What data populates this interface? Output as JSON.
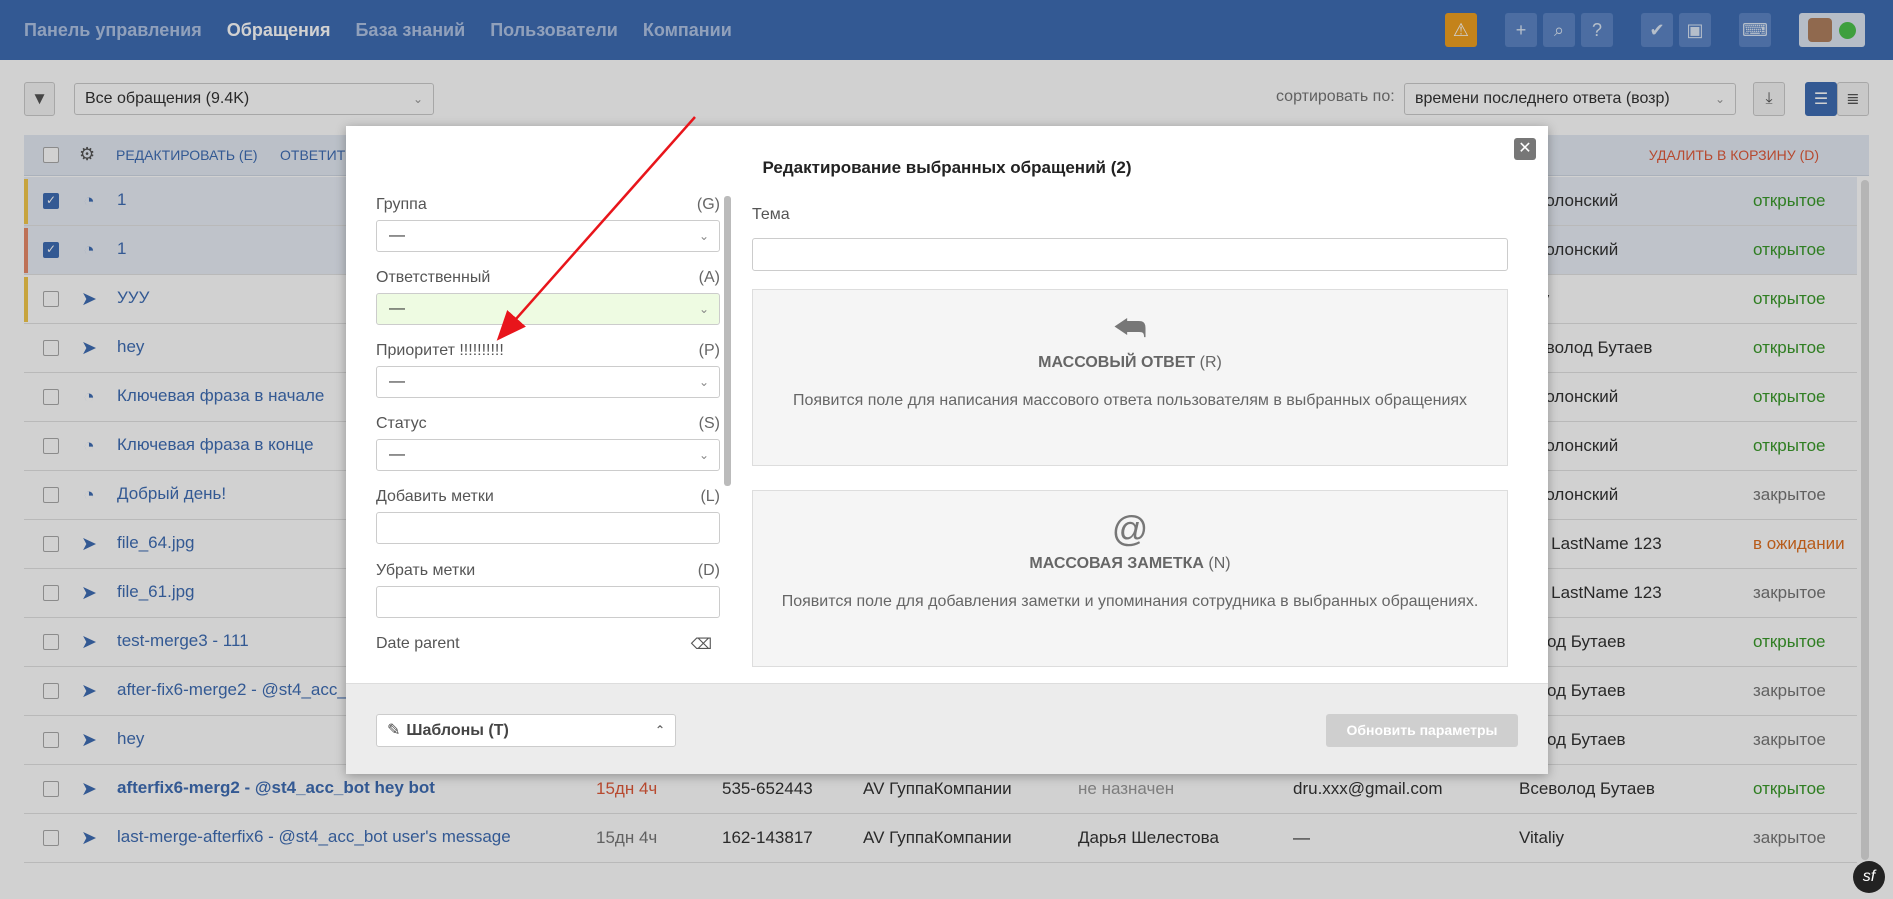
{
  "topbar": {
    "nav": [
      "Панель управления",
      "Обращения",
      "База знаний",
      "Пользователи",
      "Компании"
    ],
    "icons": [
      "warning-icon",
      "plus-icon",
      "search-icon",
      "help-icon",
      "check-icon",
      "briefcase-icon",
      "keyboard-icon"
    ]
  },
  "filterbar": {
    "view_select": "Все обращения (9.4K)",
    "sort_label": "сортировать по:",
    "sort_select": "времени последнего ответа (возр)"
  },
  "listhead": {
    "edit": "РЕДАКТИРОВАТЬ (E)",
    "reply": "ОТВЕТИТЬ",
    "delete": "УДАЛИТЬ В КОРЗИНУ (D)"
  },
  "rows": [
    {
      "subject": "1",
      "who": "н Полонский",
      "status": "открытое",
      "stclass": "open",
      "checked": true,
      "bar": "#f3c84b",
      "icon": "gauge"
    },
    {
      "subject": "1",
      "who": "н Полонский",
      "status": "открытое",
      "stclass": "open",
      "checked": true,
      "bar": "#e88a6a",
      "icon": "gauge"
    },
    {
      "subject": "УУУ",
      "who": "taliy",
      "status": "открытое",
      "stclass": "open",
      "checked": false,
      "bar": "#f3c84b",
      "icon": "plane"
    },
    {
      "subject": "hey",
      "who": "всеволод Бутаев",
      "status": "открытое",
      "stclass": "open",
      "checked": false,
      "bar": "",
      "icon": "plane"
    },
    {
      "subject": "Ключевая фраза в начале",
      "who": "н Полонский",
      "status": "открытое",
      "stclass": "open",
      "checked": false,
      "bar": "",
      "icon": "gauge"
    },
    {
      "subject": "Ключевая фраза в конце",
      "who": "н Полонский",
      "status": "открытое",
      "stclass": "open",
      "checked": false,
      "bar": "",
      "icon": "gauge"
    },
    {
      "subject": "Добрый день!",
      "who": "н Полонский",
      "status": "закрытое",
      "stclass": "closed",
      "checked": false,
      "bar": "",
      "icon": "gauge"
    },
    {
      "subject": "file_64.jpg",
      "who": "rew LastName 123",
      "status": "в ожидании",
      "stclass": "wait",
      "checked": false,
      "bar": "",
      "icon": "plane"
    },
    {
      "subject": "file_61.jpg",
      "who": "rew LastName 123",
      "status": "закрытое",
      "stclass": "closed",
      "checked": false,
      "bar": "",
      "icon": "plane"
    },
    {
      "subject": "test-merge3 - 111",
      "who": "волод Бутаев",
      "status": "открытое",
      "stclass": "open",
      "checked": false,
      "bar": "",
      "icon": "plane"
    },
    {
      "subject": "after-fix6-merge2 - @st4_acc_",
      "who": "волод Бутаев",
      "status": "закрытое",
      "stclass": "closed",
      "checked": false,
      "bar": "",
      "icon": "plane"
    },
    {
      "subject": "hey",
      "who": "волод Бутаев",
      "status": "закрытое",
      "stclass": "closed",
      "checked": false,
      "bar": "",
      "icon": "plane"
    },
    {
      "subject": "afterfix6-merg2 - @st4_acc_bot hey bot",
      "bold": true,
      "age": "15дн 4ч",
      "age_color": "#e05a3a",
      "id": "535-652443",
      "company": "AV ГуппаКомпании",
      "assignee": "не назначен",
      "assignee_color": "#999",
      "email": "dru.xxx@gmail.com",
      "who": "Всеволод Бутаев",
      "status": "открытое",
      "stclass": "open",
      "checked": false,
      "bar": "",
      "icon": "plane"
    },
    {
      "subject": "last-merge-afterfix6 - @st4_acc_bot user's message",
      "age": "15дн 4ч",
      "age_color": "#777",
      "id": "162-143817",
      "company": "AV ГуппаКомпании",
      "assignee": "Дарья Шелестова",
      "assignee_color": "#333",
      "email": "—",
      "who": "Vitaliy",
      "status": "закрытое",
      "stclass": "closed",
      "checked": false,
      "bar": "",
      "icon": "plane"
    }
  ],
  "modal": {
    "title": "Редактирование выбранных обращений (2)",
    "close": "✕",
    "fields": {
      "group_label": "Группа",
      "group_key": "(G)",
      "group_value": "—",
      "assignee_label": "Ответственный",
      "assignee_key": "(A)",
      "assignee_value": "—",
      "priority_label": "Приоритет !!!!!!!!!!",
      "priority_key": "(P)",
      "priority_value": "—",
      "status_label": "Статус",
      "status_key": "(S)",
      "status_value": "—",
      "add_tags_label": "Добавить метки",
      "add_tags_key": "(L)",
      "remove_tags_label": "Убрать метки",
      "remove_tags_key": "(D)",
      "date_parent_label": "Date parent"
    },
    "theme_label": "Тема",
    "mass_reply": {
      "title": "МАССОВЫЙ ОТВЕТ",
      "key": " (R)",
      "desc": "Появится поле для написания массового ответа пользователям в выбранных обращениях"
    },
    "mass_note": {
      "title": "МАССОВАЯ ЗАМЕТКА",
      "key": " (N)",
      "desc": "Появится поле для добавления заметки и упоминания сотрудника в выбранных обращениях."
    },
    "templates": "Шаблоны (T)",
    "update_button": "Обновить параметры"
  },
  "colors": {
    "brand": "#3f6db4",
    "open": "#3a9a2a",
    "wait": "#e07020",
    "arrow": "#e8151b"
  }
}
